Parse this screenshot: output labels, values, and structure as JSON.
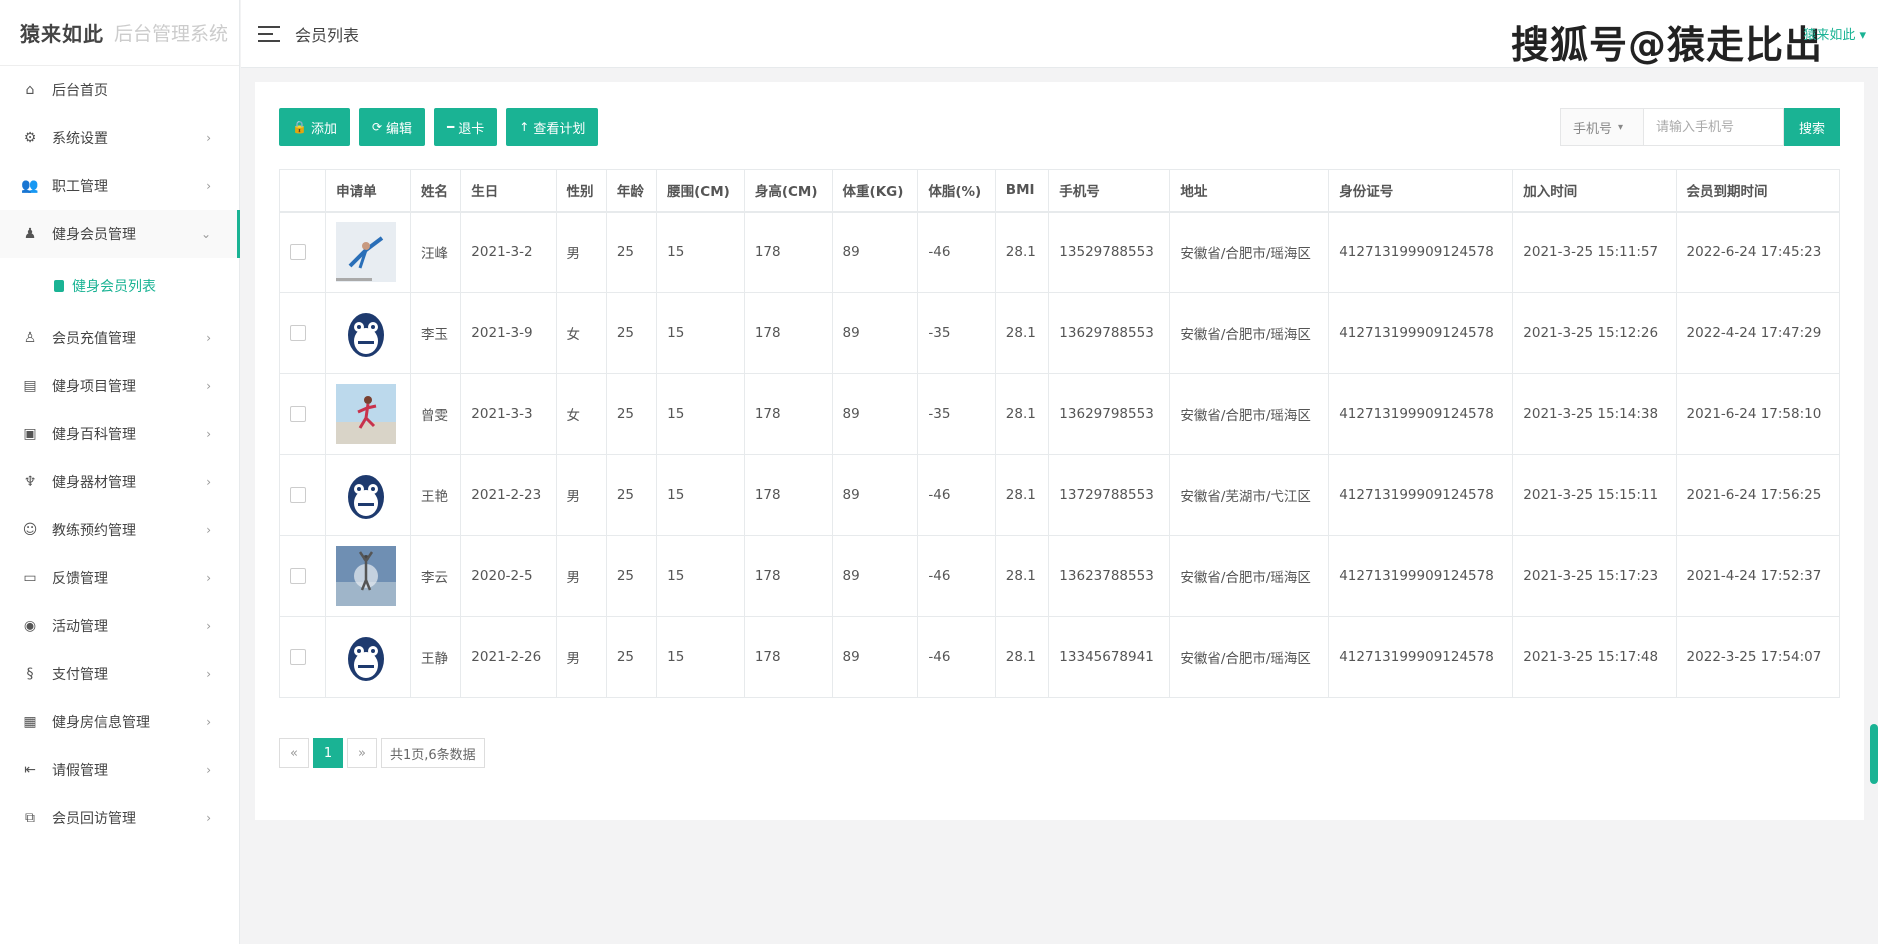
{
  "brand": {
    "logo": "猿来如此",
    "subtitle": "后台管理系统"
  },
  "topbar": {
    "breadcrumb": "会员列表",
    "watermark": "搜狐号@猿走比出",
    "user": "猿来如此"
  },
  "sidebar": {
    "items": [
      {
        "label": "后台首页",
        "icon": "home-icon",
        "glyph": "⌂",
        "arrow": ""
      },
      {
        "label": "系统设置",
        "icon": "gear-icon",
        "glyph": "⚙",
        "arrow": "›"
      },
      {
        "label": "职工管理",
        "icon": "users-icon",
        "glyph": "👥",
        "arrow": "›"
      },
      {
        "label": "健身会员管理",
        "icon": "android-icon",
        "glyph": "♟",
        "arrow": "⌄",
        "active": true
      },
      {
        "label": "会员充值管理",
        "icon": "person-icon",
        "glyph": "♙",
        "arrow": "›"
      },
      {
        "label": "健身项目管理",
        "icon": "file-chart-icon",
        "glyph": "▤",
        "arrow": "›"
      },
      {
        "label": "健身百科管理",
        "icon": "folder-image-icon",
        "glyph": "▣",
        "arrow": "›"
      },
      {
        "label": "健身器材管理",
        "icon": "fitness-icon",
        "glyph": "♆",
        "arrow": "›"
      },
      {
        "label": "教练预约管理",
        "icon": "mask-icon",
        "glyph": "☺",
        "arrow": "›"
      },
      {
        "label": "反馈管理",
        "icon": "window-icon",
        "glyph": "▭",
        "arrow": "›"
      },
      {
        "label": "活动管理",
        "icon": "target-icon",
        "glyph": "◉",
        "arrow": "›"
      },
      {
        "label": "支付管理",
        "icon": "section-icon",
        "glyph": "§",
        "arrow": "›"
      },
      {
        "label": "健身房信息管理",
        "icon": "building-icon",
        "glyph": "▦",
        "arrow": "›"
      },
      {
        "label": "请假管理",
        "icon": "arrow-left-bar-icon",
        "glyph": "⇤",
        "arrow": "›"
      },
      {
        "label": "会员回访管理",
        "icon": "clone-icon",
        "glyph": "⧉",
        "arrow": "›"
      }
    ],
    "submenu": {
      "label": "健身会员列表"
    }
  },
  "toolbar": {
    "add": "添加",
    "edit": "编辑",
    "refund": "退卡",
    "plan": "查看计划"
  },
  "search": {
    "select": "手机号",
    "placeholder": "请输入手机号",
    "button": "搜索"
  },
  "table": {
    "headers": [
      "申请单",
      "姓名",
      "生日",
      "性别",
      "年龄",
      "腰围(CM)",
      "身高(CM)",
      "体重(KG)",
      "体脂(%)",
      "BMI",
      "手机号",
      "地址",
      "身份证号",
      "加入时间",
      "会员到期时间"
    ],
    "rows": [
      {
        "photo": "photo-dancer",
        "name": "汪峰",
        "birthday": "2021-3-2",
        "gender": "男",
        "age": "25",
        "waist": "15",
        "height": "178",
        "weight": "89",
        "bodyfat": "-46",
        "bmi": "28.1",
        "phone": "13529788553",
        "address": "安徽省/合肥市/瑶海区",
        "idcard": "412713199909124578",
        "join": "2021-3-25 15:11:57",
        "expire": "2022-6-24 17:45:23"
      },
      {
        "photo": "photo-monkey",
        "name": "李玉",
        "birthday": "2021-3-9",
        "gender": "女",
        "age": "25",
        "waist": "15",
        "height": "178",
        "weight": "89",
        "bodyfat": "-35",
        "bmi": "28.1",
        "phone": "13629788553",
        "address": "安徽省/合肥市/瑶海区",
        "idcard": "412713199909124578",
        "join": "2021-3-25 15:12:26",
        "expire": "2022-4-24 17:47:29"
      },
      {
        "photo": "photo-runner",
        "name": "曾雯",
        "birthday": "2021-3-3",
        "gender": "女",
        "age": "25",
        "waist": "15",
        "height": "178",
        "weight": "89",
        "bodyfat": "-35",
        "bmi": "28.1",
        "phone": "13629798553",
        "address": "安徽省/合肥市/瑶海区",
        "idcard": "412713199909124578",
        "join": "2021-3-25 15:14:38",
        "expire": "2021-6-24 17:58:10"
      },
      {
        "photo": "photo-monkey",
        "name": "王艳",
        "birthday": "2021-2-23",
        "gender": "男",
        "age": "25",
        "waist": "15",
        "height": "178",
        "weight": "89",
        "bodyfat": "-46",
        "bmi": "28.1",
        "phone": "13729788553",
        "address": "安徽省/芜湖市/弋江区",
        "idcard": "412713199909124578",
        "join": "2021-3-25 15:15:11",
        "expire": "2021-6-24 17:56:25"
      },
      {
        "photo": "photo-yoga",
        "name": "李云",
        "birthday": "2020-2-5",
        "gender": "男",
        "age": "25",
        "waist": "15",
        "height": "178",
        "weight": "89",
        "bodyfat": "-46",
        "bmi": "28.1",
        "phone": "13623788553",
        "address": "安徽省/合肥市/瑶海区",
        "idcard": "412713199909124578",
        "join": "2021-3-25 15:17:23",
        "expire": "2021-4-24 17:52:37"
      },
      {
        "photo": "photo-monkey",
        "name": "王静",
        "birthday": "2021-2-26",
        "gender": "男",
        "age": "25",
        "waist": "15",
        "height": "178",
        "weight": "89",
        "bodyfat": "-46",
        "bmi": "28.1",
        "phone": "13345678941",
        "address": "安徽省/合肥市/瑶海区",
        "idcard": "412713199909124578",
        "join": "2021-3-25 15:17:48",
        "expire": "2022-3-25 17:54:07"
      }
    ]
  },
  "pagination": {
    "prev": "«",
    "current": "1",
    "next": "»",
    "info": "共1页,6条数据"
  },
  "colors": {
    "accent": "#1ab394",
    "female": "#23a0d8"
  }
}
